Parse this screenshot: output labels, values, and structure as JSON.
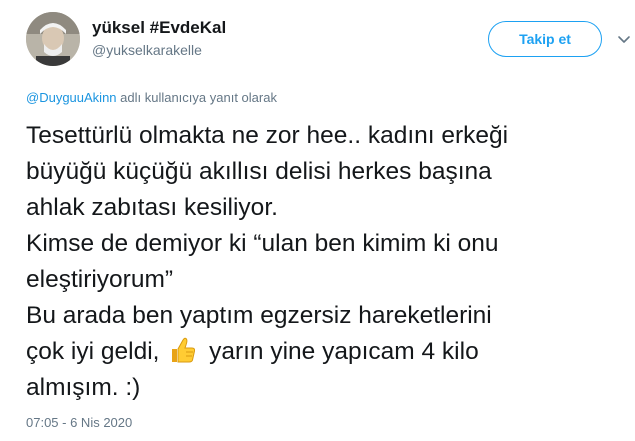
{
  "user": {
    "display_name": "yüksel #EvdeKal",
    "handle": "@yukselkarakelle"
  },
  "actions": {
    "follow_label": "Takip et"
  },
  "reply_context": {
    "mention": "@DuyguuAkinn",
    "text": " adlı kullanıcıya yanıt olarak"
  },
  "tweet": {
    "lines": [
      "Tesettürlü olmakta ne zor hee.. kadını erkeği",
      "büyüğü küçüğü akıllısı delisi herkes başına",
      "ahlak zabıtası kesiliyor.",
      "Kimse de demiyor ki “ulan ben kimim ki onu",
      "eleştiriyorum”",
      "Bu arada ben yaptım egzersiz hareketlerini",
      "çok iyi geldi,",
      "yarın yine yapıcam 4 kilo",
      "almışım. :)"
    ],
    "emoji": "thumbs-up-icon"
  },
  "timestamp": "07:05 - 6 Nis 2020",
  "colors": {
    "accent": "#1da1f2",
    "secondary_text": "#657786",
    "primary_text": "#14171a"
  }
}
